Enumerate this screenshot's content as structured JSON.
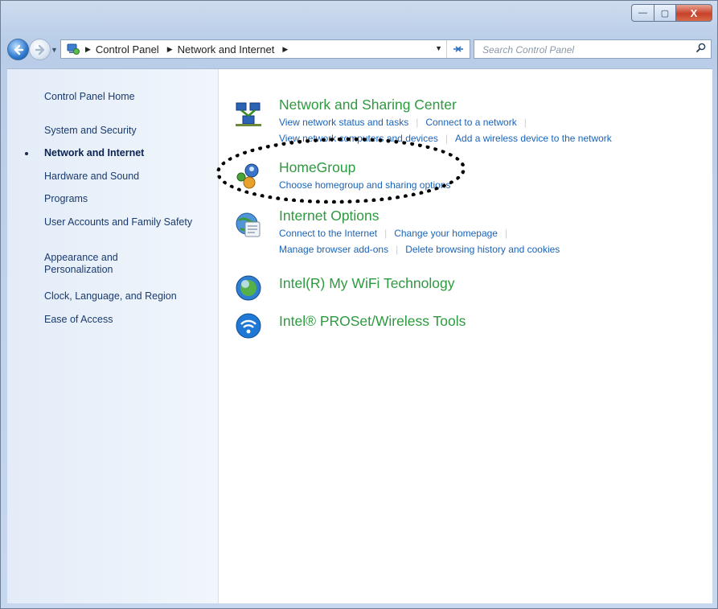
{
  "window": {
    "buttons": {
      "minimize": "—",
      "maximize": "▢",
      "close": "X"
    }
  },
  "navbar": {
    "back_icon": "back-arrow-icon",
    "forward_icon": "forward-arrow-icon",
    "breadcrumb": [
      "Control Panel",
      "Network and Internet"
    ],
    "search_placeholder": "Search Control Panel"
  },
  "sidebar": {
    "items": [
      {
        "label": "Control Panel Home"
      },
      {
        "label": "System and Security"
      },
      {
        "label": "Network and Internet",
        "active": true
      },
      {
        "label": "Hardware and Sound"
      },
      {
        "label": "Programs"
      },
      {
        "label": "User Accounts and Family Safety"
      },
      {
        "label": "Appearance and Personalization"
      },
      {
        "label": "Clock, Language, and Region"
      },
      {
        "label": "Ease of Access"
      }
    ]
  },
  "categories": [
    {
      "title": "Network and Sharing Center",
      "icon": "network-sharing-icon",
      "links": [
        [
          "View network status and tasks",
          "Connect to a network"
        ],
        [
          "View network computers and devices",
          "Add a wireless device to the network"
        ]
      ]
    },
    {
      "title": "HomeGroup",
      "icon": "homegroup-icon",
      "links": [
        [
          "Choose homegroup and sharing options"
        ]
      ]
    },
    {
      "title": "Internet Options",
      "icon": "internet-options-icon",
      "links": [
        [
          "Connect to the Internet",
          "Change your homepage"
        ],
        [
          "Manage browser add-ons",
          "Delete browsing history and cookies"
        ]
      ]
    },
    {
      "title": "Intel(R) My WiFi Technology",
      "icon": "intel-wifi-icon",
      "links": []
    },
    {
      "title": "Intel® PROSet/Wireless Tools",
      "icon": "intel-proset-wireless-icon",
      "links": []
    }
  ]
}
